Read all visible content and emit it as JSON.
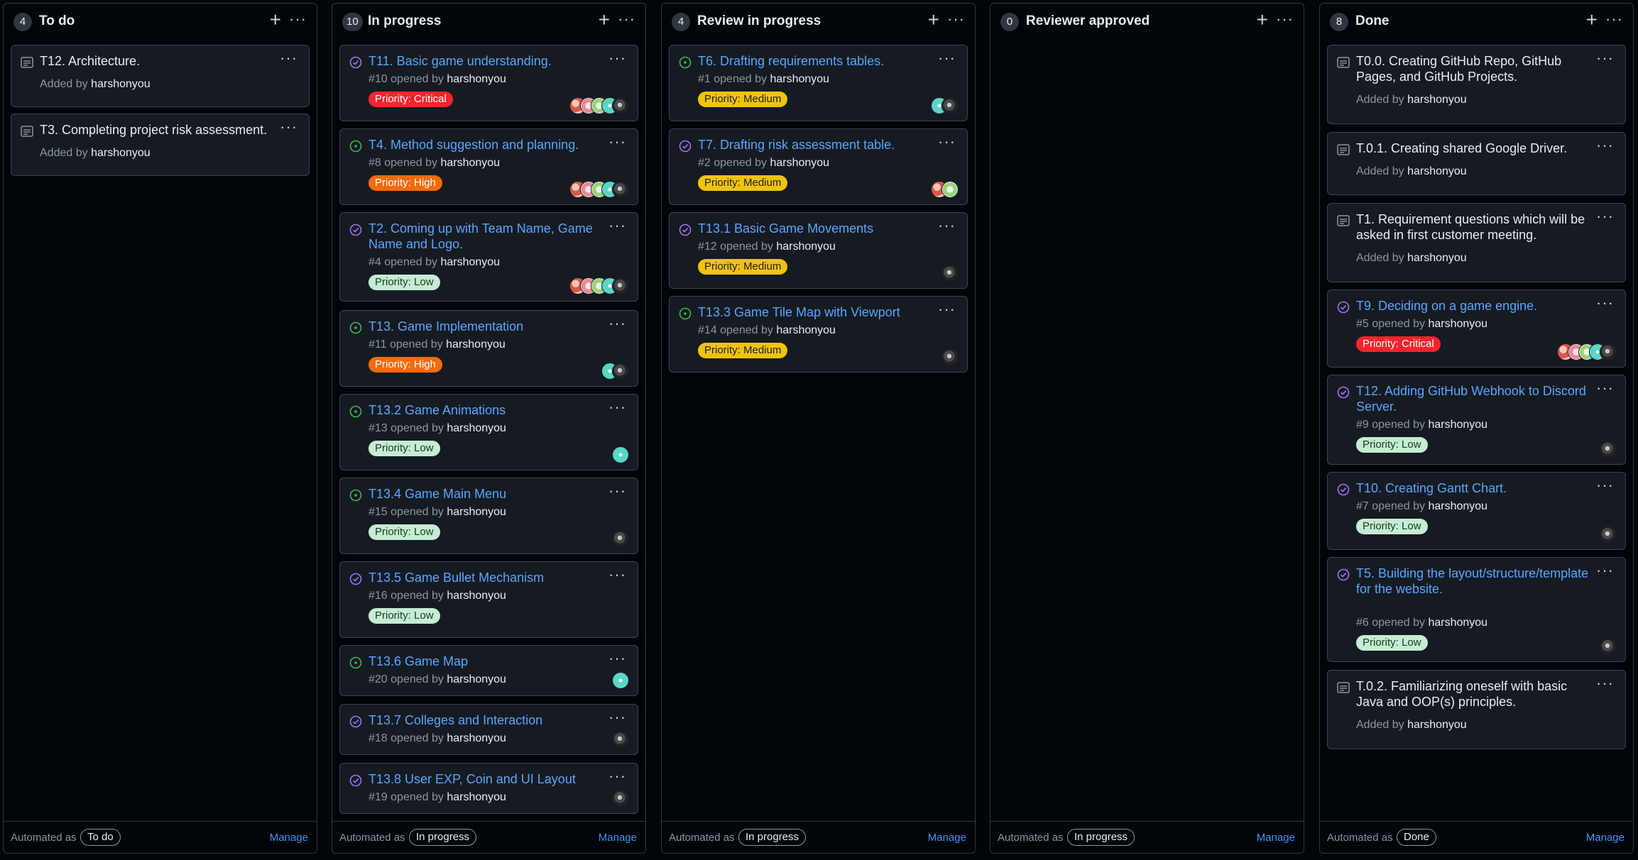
{
  "colors": {
    "link": "#58a6ff",
    "open_issue": "#3fb950",
    "closed_issue": "#a371f7",
    "priority_critical": "#f5242d",
    "priority_high": "#f66a0a",
    "priority_medium": "#f0c40c",
    "priority_low": "#c5ecd4"
  },
  "footer_text": "Automated as",
  "manage_label": "Manage",
  "columns": [
    {
      "count": "4",
      "title": "To do",
      "automation": "To do",
      "cards": [
        {
          "kind": "note",
          "title": "T12. Architecture.",
          "meta_prefix": "Added by",
          "meta_user": "harshonyou"
        },
        {
          "kind": "note",
          "title": "T3. Completing project risk assessment.",
          "meta_prefix": "Added by",
          "meta_user": "harshonyou"
        }
      ]
    },
    {
      "count": "10",
      "title": "In progress",
      "automation": "In progress",
      "cards": [
        {
          "kind": "issue",
          "state": "closed",
          "title": "T11. Basic game understanding.",
          "meta_prefix": "#10 opened by",
          "meta_user": "harshonyou",
          "label": "Priority: Critical",
          "label_level": "critical",
          "avatars": [
            "a-red",
            "a-pink",
            "a-green",
            "a-teal",
            "a-dark"
          ]
        },
        {
          "kind": "issue",
          "state": "open",
          "title": "T4. Method suggestion and planning.",
          "meta_prefix": "#8 opened by",
          "meta_user": "harshonyou",
          "label": "Priority: High",
          "label_level": "high",
          "avatars": [
            "a-red",
            "a-pink",
            "a-green",
            "a-teal",
            "a-dark"
          ]
        },
        {
          "kind": "issue",
          "state": "closed",
          "title": "T2. Coming up with Team Name, Game Name and Logo.",
          "meta_prefix": "#4 opened by",
          "meta_user": "harshonyou",
          "label": "Priority: Low",
          "label_level": "low",
          "avatars": [
            "a-red",
            "a-pink",
            "a-green",
            "a-teal",
            "a-dark"
          ]
        },
        {
          "kind": "issue",
          "state": "open",
          "title": "T13. Game Implementation",
          "meta_prefix": "#11 opened by",
          "meta_user": "harshonyou",
          "label": "Priority: High",
          "label_level": "high",
          "avatars": [
            "a-teal",
            "a-dark"
          ]
        },
        {
          "kind": "issue",
          "state": "open",
          "title": "T13.2 Game Animations",
          "meta_prefix": "#13 opened by",
          "meta_user": "harshonyou",
          "label": "Priority: Low",
          "label_level": "low",
          "avatars": [
            "a-teal"
          ]
        },
        {
          "kind": "issue",
          "state": "open",
          "title": "T13.4 Game Main Menu",
          "meta_prefix": "#15 opened by",
          "meta_user": "harshonyou",
          "label": "Priority: Low",
          "label_level": "low",
          "avatars": [
            "a-dark"
          ]
        },
        {
          "kind": "issue",
          "state": "closed",
          "title": "T13.5 Game Bullet Mechanism",
          "meta_prefix": "#16 opened by",
          "meta_user": "harshonyou",
          "label": "Priority: Low",
          "label_level": "low",
          "avatars": []
        },
        {
          "kind": "issue",
          "state": "open",
          "title": "T13.6 Game Map",
          "meta_prefix": "#20 opened by",
          "meta_user": "harshonyou",
          "avatars": [
            "a-teal"
          ]
        },
        {
          "kind": "issue",
          "state": "closed",
          "title": "T13.7 Colleges and Interaction",
          "meta_prefix": "#18 opened by",
          "meta_user": "harshonyou",
          "avatars": [
            "a-dark"
          ]
        },
        {
          "kind": "issue",
          "state": "closed",
          "title": "T13.8 User EXP, Coin and UI Layout",
          "meta_prefix": "#19 opened by",
          "meta_user": "harshonyou",
          "avatars": [
            "a-dark"
          ]
        }
      ]
    },
    {
      "count": "4",
      "title": "Review in progress",
      "automation": "In progress",
      "cards": [
        {
          "kind": "issue",
          "state": "open",
          "title": "T6. Drafting requirements tables.",
          "meta_prefix": "#1 opened by",
          "meta_user": "harshonyou",
          "label": "Priority: Medium",
          "label_level": "medium",
          "avatars": [
            "a-teal",
            "a-dark"
          ]
        },
        {
          "kind": "issue",
          "state": "closed",
          "title": "T7. Drafting risk assessment table.",
          "meta_prefix": "#2 opened by",
          "meta_user": "harshonyou",
          "label": "Priority: Medium",
          "label_level": "medium",
          "avatars": [
            "a-red",
            "a-green"
          ]
        },
        {
          "kind": "issue",
          "state": "closed",
          "title": "T13.1 Basic Game Movements",
          "meta_prefix": "#12 opened by",
          "meta_user": "harshonyou",
          "label": "Priority: Medium",
          "label_level": "medium",
          "avatars": [
            "a-dark"
          ]
        },
        {
          "kind": "issue",
          "state": "open",
          "title": "T13.3 Game Tile Map with Viewport",
          "meta_prefix": "#14 opened by",
          "meta_user": "harshonyou",
          "label": "Priority: Medium",
          "label_level": "medium",
          "avatars": [
            "a-dark"
          ]
        }
      ]
    },
    {
      "count": "0",
      "title": "Reviewer approved",
      "automation": "In progress",
      "cards": []
    },
    {
      "count": "8",
      "title": "Done",
      "automation": "Done",
      "cards": [
        {
          "kind": "note",
          "title": "T0.0. Creating GitHub Repo, GitHub Pages, and GitHub Projects.",
          "meta_prefix": "Added by",
          "meta_user": "harshonyou"
        },
        {
          "kind": "note",
          "title": "T.0.1. Creating shared Google Driver.",
          "meta_prefix": "Added by",
          "meta_user": "harshonyou"
        },
        {
          "kind": "note",
          "title": "T1. Requirement questions which will be asked in first customer meeting.",
          "meta_prefix": "Added by",
          "meta_user": "harshonyou"
        },
        {
          "kind": "issue",
          "state": "closed",
          "title": "T9. Deciding on a game engine.",
          "meta_prefix": "#5 opened by",
          "meta_user": "harshonyou",
          "label": "Priority: Critical",
          "label_level": "critical",
          "avatars": [
            "a-red",
            "a-pink",
            "a-green",
            "a-teal",
            "a-dark"
          ]
        },
        {
          "kind": "issue",
          "state": "closed",
          "title": "T12. Adding GitHub Webhook to Discord Server.",
          "meta_prefix": "#9 opened by",
          "meta_user": "harshonyou",
          "label": "Priority: Low",
          "label_level": "low",
          "avatars": [
            "a-dark"
          ]
        },
        {
          "kind": "issue",
          "state": "closed",
          "title": "T10. Creating Gantt Chart.",
          "meta_prefix": "#7 opened by",
          "meta_user": "harshonyou",
          "label": "Priority: Low",
          "label_level": "low",
          "avatars": [
            "a-dark"
          ]
        },
        {
          "kind": "issue",
          "state": "closed",
          "title": "T5. Building the layout/structure/template for the website.",
          "meta_prefix": "#6 opened by",
          "meta_user": "harshonyou",
          "label": "Priority: Low",
          "label_level": "low",
          "avatars": [
            "a-dark"
          ]
        },
        {
          "kind": "note",
          "title": "T.0.2. Familiarizing oneself with basic Java and OOP(s) principles.",
          "meta_prefix": "Added by",
          "meta_user": "harshonyou"
        }
      ]
    }
  ]
}
